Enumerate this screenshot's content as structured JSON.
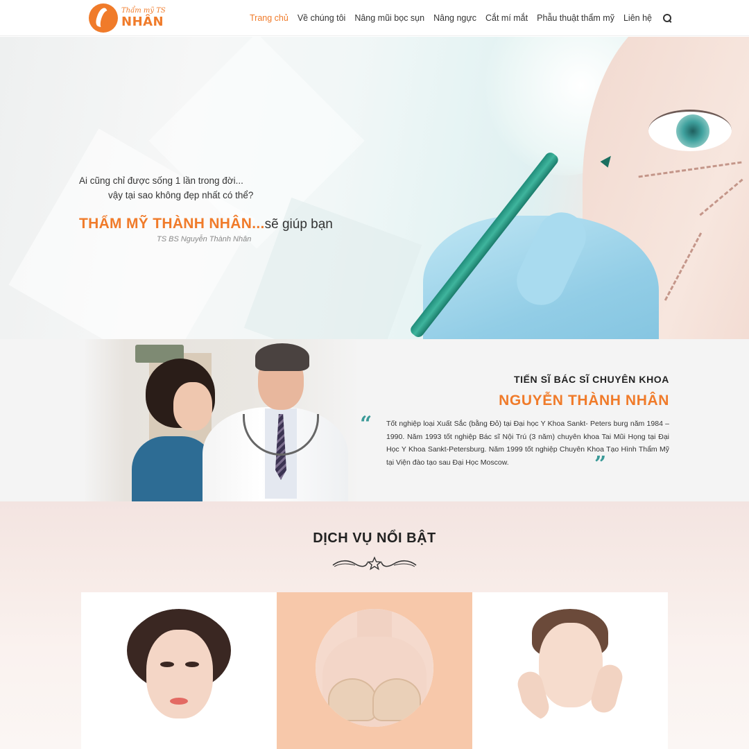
{
  "header": {
    "logo": {
      "sub": "Thẩm mỹ TS",
      "main": "NHÂN"
    },
    "nav": [
      {
        "label": "Trang chủ",
        "active": true
      },
      {
        "label": "Về chúng tôi"
      },
      {
        "label": "Nâng mũi bọc sụn"
      },
      {
        "label": "Nâng ngực"
      },
      {
        "label": "Cắt mí mắt"
      },
      {
        "label": "Phẫu thuật thẩm mỹ"
      },
      {
        "label": "Liên hệ"
      }
    ],
    "search_icon": "search-icon"
  },
  "hero": {
    "line1": "Ai cũng chỉ được sống 1 lần trong đời...",
    "line2": "vậy tại sao không đẹp nhất có thể?",
    "brand": "THẨM MỸ THÀNH NHÂN...",
    "brand_suffix": "sẽ giúp bạn",
    "signature": "TS BS Nguyễn Thành Nhân"
  },
  "doctor": {
    "role": "TIẾN SĨ BÁC SĨ CHUYÊN KHOA",
    "name": "NGUYỄN THÀNH NHÂN",
    "quote_open": "“",
    "quote_close": "”",
    "description": "Tốt nghiệp loại Xuất Sắc (bằng Đỏ) tại Đại học Y Khoa Sankt- Peters burg năm 1984 – 1990. Năm 1993 tốt nghiệp Bác sĩ Nội Trú (3 năm) chuyên khoa Tai Mũi Họng tại Đại Học Y Khoa Sankt-Petersburg. Năm 1999 tốt nghiệp Chuyên Khoa Tạo Hình Thẩm Mỹ tại Viện đào tạo sau Đại Học Moscow."
  },
  "services": {
    "title": "DỊCH VỤ NỔI BẬT",
    "ornament_icon": "star-icon",
    "cards": [
      {
        "image": "woman-face-portrait"
      },
      {
        "image": "breast-augmentation"
      },
      {
        "image": "woman-skincare"
      }
    ]
  },
  "colors": {
    "accent": "#f07b2a",
    "quote": "#3a9a98",
    "text": "#333333"
  }
}
